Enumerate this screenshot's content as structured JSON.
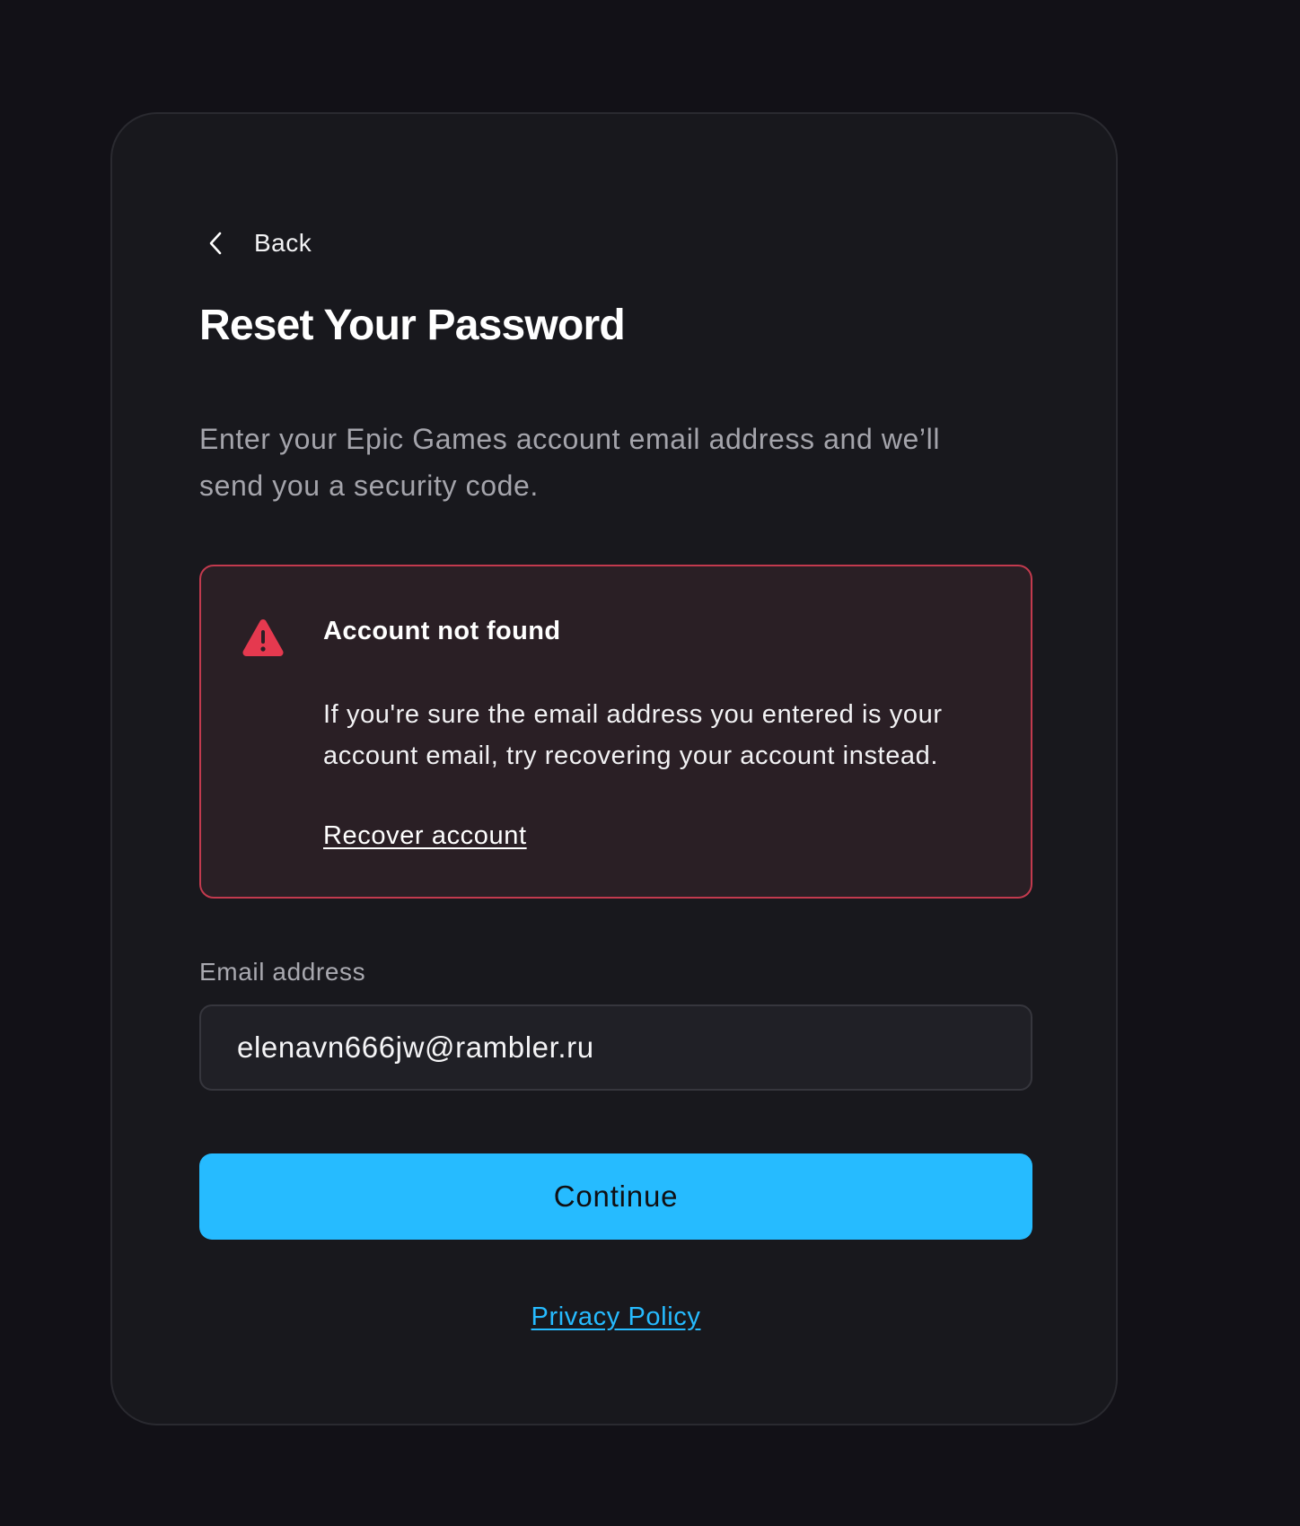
{
  "back": {
    "label": "Back",
    "icon": "chevron-left-icon"
  },
  "title": "Reset Your Password",
  "subtitle": "Enter your Epic Games account email address and we’ll send you a security code.",
  "alert": {
    "icon": "warning-icon",
    "title": "Account not found",
    "body": "If you're sure the email address you entered is your account email, try recovering your account instead.",
    "link": "Recover account",
    "color": "#e5394f"
  },
  "email": {
    "label": "Email address",
    "value": "elenavn666jw@rambler.ru"
  },
  "continue_label": "Continue",
  "privacy_label": "Privacy Policy",
  "colors": {
    "accent": "#26bbff",
    "background": "#121117",
    "card": "#18181d"
  }
}
